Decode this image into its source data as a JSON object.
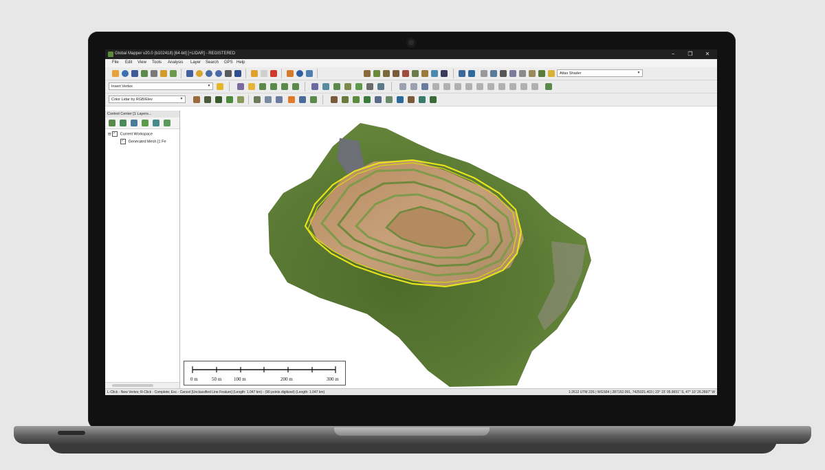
{
  "window": {
    "title": "Global Mapper v20.0 (b102418) [64-bit] [+LIDAR] - REGISTERED",
    "controls": {
      "minimize": "−",
      "maximize": "❐",
      "close": "✕"
    }
  },
  "menu": [
    "File",
    "Edit",
    "View",
    "Tools",
    "Analysis",
    "Layer",
    "Search",
    "GPS",
    "Help"
  ],
  "toolbars": {
    "vertex_mode": "Insert Vertex",
    "shader": "Atlas Shader",
    "lidar_color": "Color Lidar by RGB/Elev"
  },
  "control_center": {
    "title": "Control Center [1 Layers...",
    "tree": [
      {
        "label": "Current Workspace"
      },
      {
        "label": "Generated Mesh [1 Fe"
      }
    ]
  },
  "scale_bar": {
    "labels": [
      "0 m",
      "50 m",
      "100 m",
      "200 m",
      "300 m"
    ]
  },
  "status": {
    "left": "L-Click - New Vertex; R-Click - Complete; Esc - Cancel [Unclassified Line Feature] (Length: 1.047 km) - (90 points digitized) (Length: 1.047 km)",
    "right": "1:2612   UTM 23S | WGS84 | 287152.091, 7425021.403 | 23° 15' 05.9651\" S, 47° 10' 26.2697\" W"
  },
  "colors": {
    "feature_outline": "#e6e21c",
    "titlebar": "#202020",
    "laptop_bezel": "#111111"
  }
}
